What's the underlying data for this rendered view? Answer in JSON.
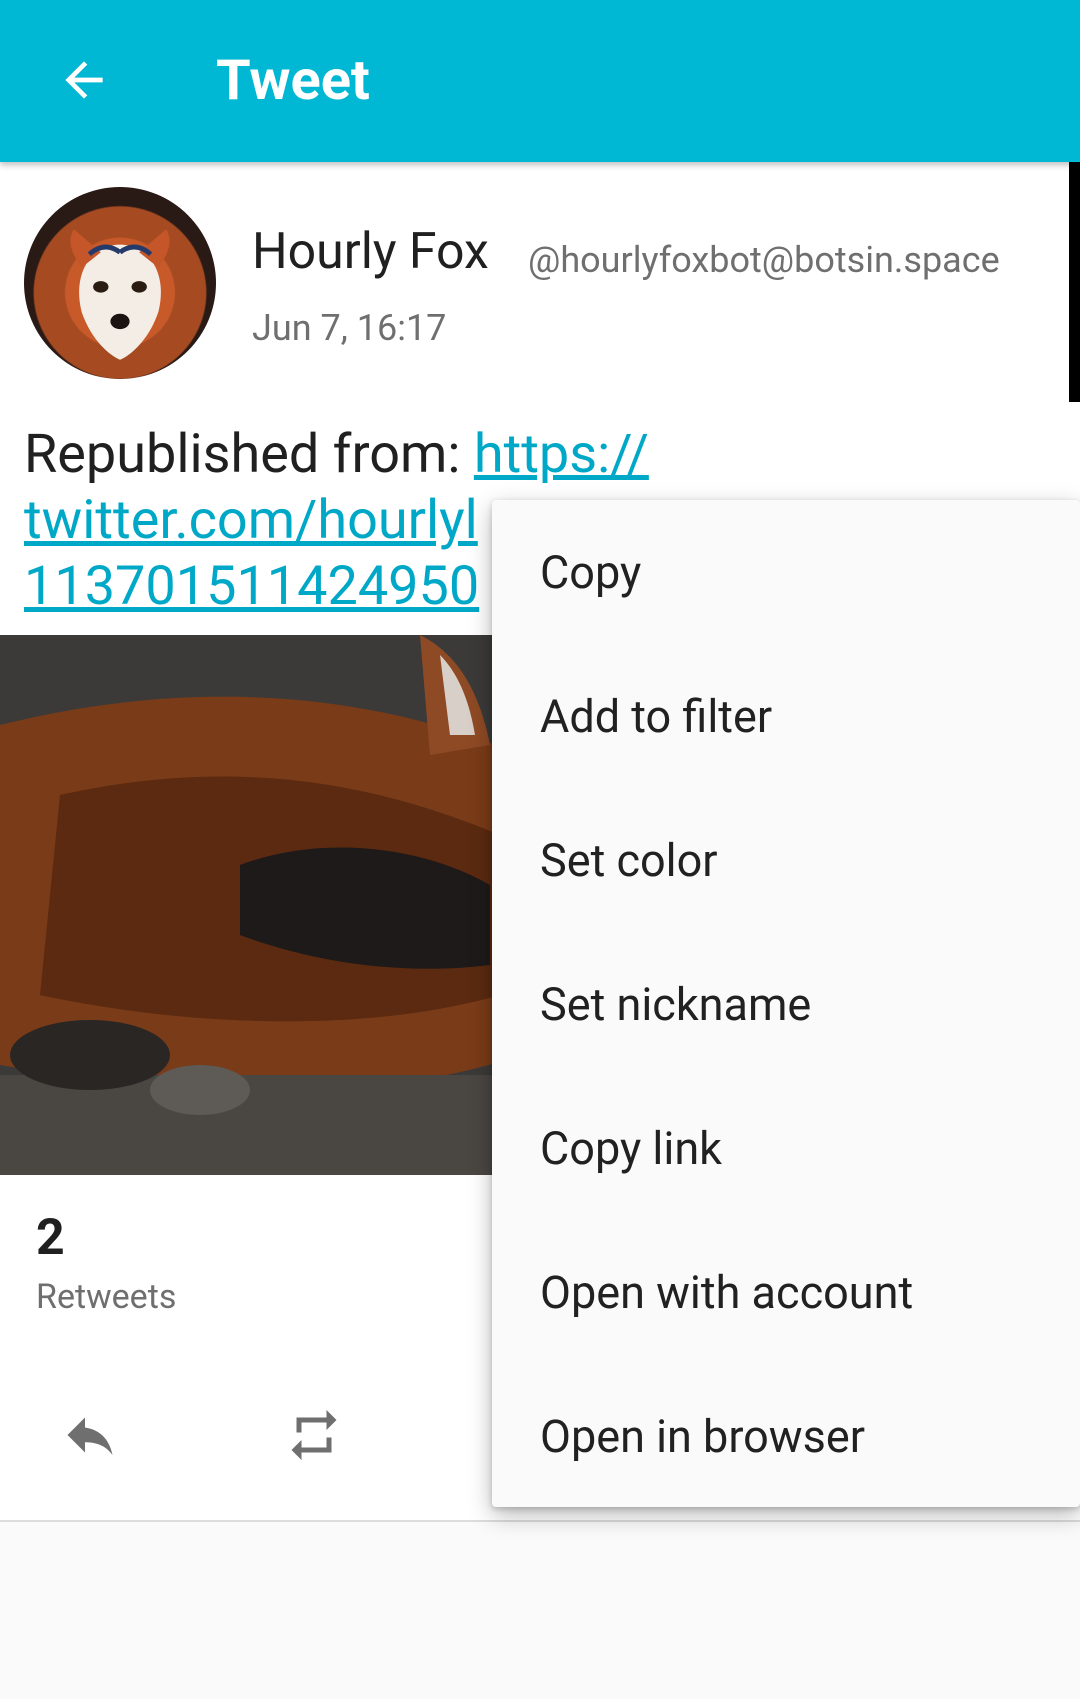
{
  "appbar": {
    "title": "Tweet",
    "back_icon": "arrow-left-icon",
    "color": "#00b8d4"
  },
  "status": {
    "display_name": "Hourly Fox",
    "handle": "@hourlyfoxbot@botsin.space",
    "time": "Jun 7, 16:17",
    "text_prefix": "Republished from: ",
    "link_line1": "https://",
    "link_line2": "twitter.com/hourlyl",
    "link_line3": "113701511424950"
  },
  "stats": {
    "count": "2",
    "label": "Retweets"
  },
  "actions": {
    "reply_icon": "reply-icon",
    "retweet_icon": "retweet-icon"
  },
  "menu": {
    "items": [
      {
        "label": "Copy"
      },
      {
        "label": "Add to filter"
      },
      {
        "label": "Set color"
      },
      {
        "label": "Set nickname"
      },
      {
        "label": "Copy link"
      },
      {
        "label": "Open with account"
      },
      {
        "label": "Open in browser"
      }
    ]
  },
  "colors": {
    "accent": "#00b8d4",
    "link": "#00a8c8"
  }
}
